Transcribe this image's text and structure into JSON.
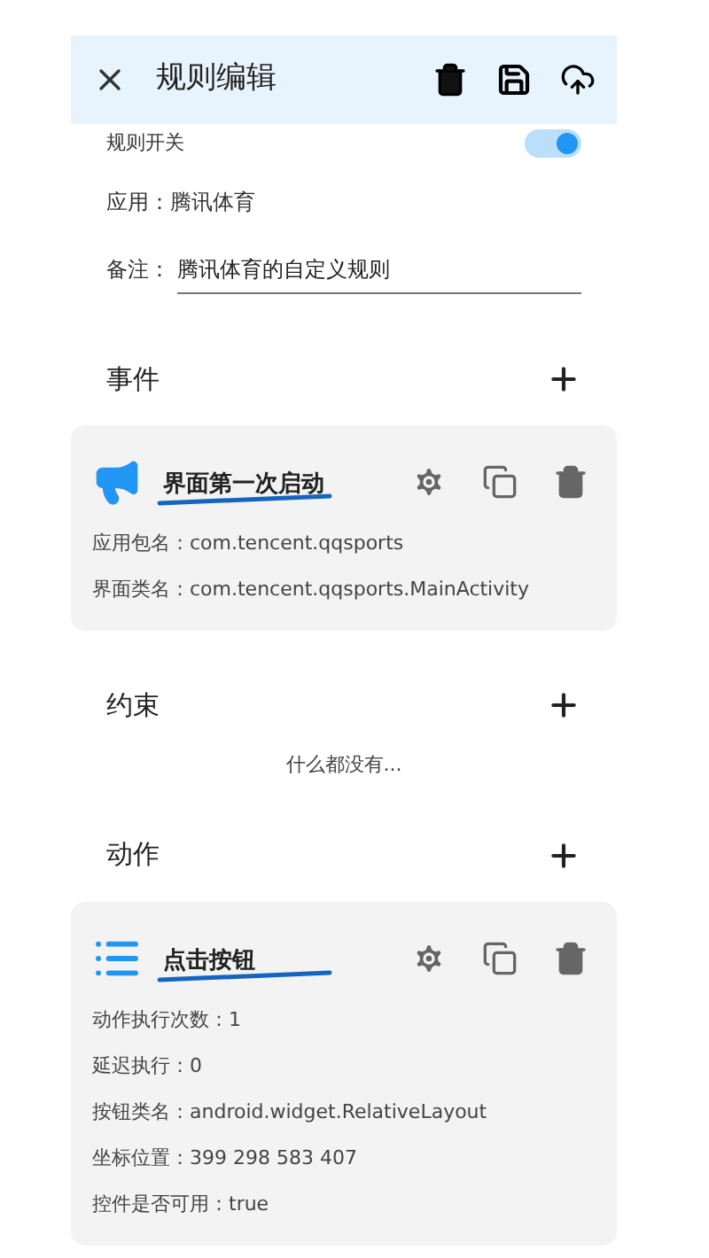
{
  "header": {
    "title": "规则编辑"
  },
  "rule_switch": {
    "label": "规则开关",
    "on": true
  },
  "app": {
    "label": "应用：",
    "value": "腾讯体育"
  },
  "note": {
    "label": "备注：",
    "value": "腾讯体育的自定义规则"
  },
  "sections": [
    {
      "title": "事件",
      "cards": [
        {
          "kind": "event",
          "title": "界面第一次启动",
          "annotated": true,
          "lines": [
            "应用包名：com.tencent.qqsports",
            "界面类名：com.tencent.qqsports.MainActivity"
          ]
        }
      ]
    },
    {
      "title": "约束",
      "empty_text": "什么都没有..."
    },
    {
      "title": "动作",
      "cards": [
        {
          "kind": "action",
          "title": "点击按钮",
          "annotated": true,
          "lines": [
            "动作执行次数：1",
            "延迟执行：0",
            "按钮类名：android.widget.RelativeLayout",
            "坐标位置：399 298 583 407",
            "控件是否可用：true"
          ]
        }
      ]
    }
  ]
}
